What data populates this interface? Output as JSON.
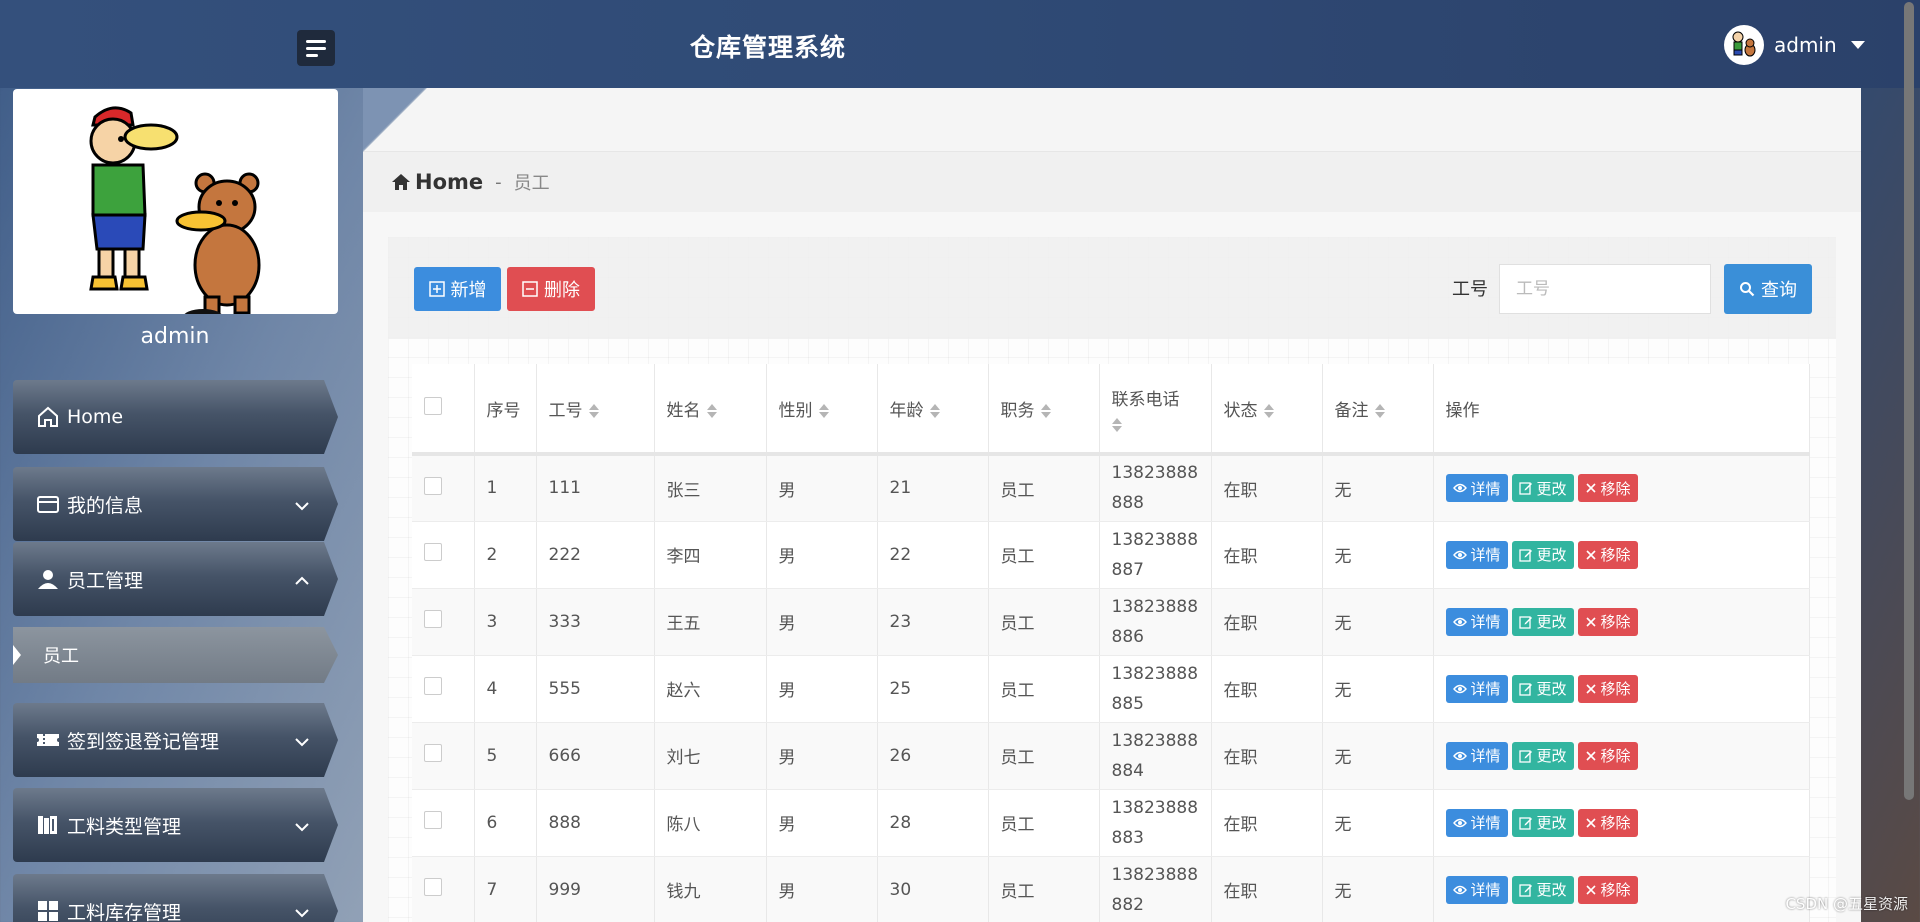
{
  "header": {
    "title": "仓库管理系统",
    "user_name": "admin"
  },
  "sidebar": {
    "profile_name": "admin",
    "items": [
      {
        "label": "Home",
        "icon": "home-icon"
      },
      {
        "label": "我的信息",
        "icon": "id-card-icon"
      },
      {
        "label": "员工管理",
        "icon": "user-icon"
      },
      {
        "label": "签到签退登记管理",
        "icon": "ticket-icon"
      },
      {
        "label": "工料类型管理",
        "icon": "books-icon"
      },
      {
        "label": "工料库存管理",
        "icon": "grid-icon"
      }
    ],
    "active_sub": "员工"
  },
  "breadcrumb": {
    "home": "Home",
    "separator": "-",
    "current": "员工"
  },
  "toolbar": {
    "add_label": "新增",
    "delete_label": "删除",
    "search_label": "工号",
    "search_placeholder": "工号",
    "search_button": "查询"
  },
  "table": {
    "headers": [
      "序号",
      "工号",
      "姓名",
      "性别",
      "年龄",
      "职务",
      "联系电话",
      "状态",
      "备注",
      "操作"
    ],
    "actions": {
      "detail": "详情",
      "edit": "更改",
      "remove": "移除"
    },
    "rows": [
      {
        "no": "1",
        "id": "111",
        "name": "张三",
        "gender": "男",
        "age": "21",
        "job": "员工",
        "phone_a": "13823888",
        "phone_b": "888",
        "status": "在职",
        "note": "无"
      },
      {
        "no": "2",
        "id": "222",
        "name": "李四",
        "gender": "男",
        "age": "22",
        "job": "员工",
        "phone_a": "13823888",
        "phone_b": "887",
        "status": "在职",
        "note": "无"
      },
      {
        "no": "3",
        "id": "333",
        "name": "王五",
        "gender": "男",
        "age": "23",
        "job": "员工",
        "phone_a": "13823888",
        "phone_b": "886",
        "status": "在职",
        "note": "无"
      },
      {
        "no": "4",
        "id": "555",
        "name": "赵六",
        "gender": "男",
        "age": "25",
        "job": "员工",
        "phone_a": "13823888",
        "phone_b": "885",
        "status": "在职",
        "note": "无"
      },
      {
        "no": "5",
        "id": "666",
        "name": "刘七",
        "gender": "男",
        "age": "26",
        "job": "员工",
        "phone_a": "13823888",
        "phone_b": "884",
        "status": "在职",
        "note": "无"
      },
      {
        "no": "6",
        "id": "888",
        "name": "陈八",
        "gender": "男",
        "age": "28",
        "job": "员工",
        "phone_a": "13823888",
        "phone_b": "883",
        "status": "在职",
        "note": "无"
      },
      {
        "no": "7",
        "id": "999",
        "name": "钱九",
        "gender": "男",
        "age": "30",
        "job": "员工",
        "phone_a": "13823888",
        "phone_b": "882",
        "status": "在职",
        "note": "无"
      }
    ]
  },
  "watermark": "CSDN @五星资源"
}
